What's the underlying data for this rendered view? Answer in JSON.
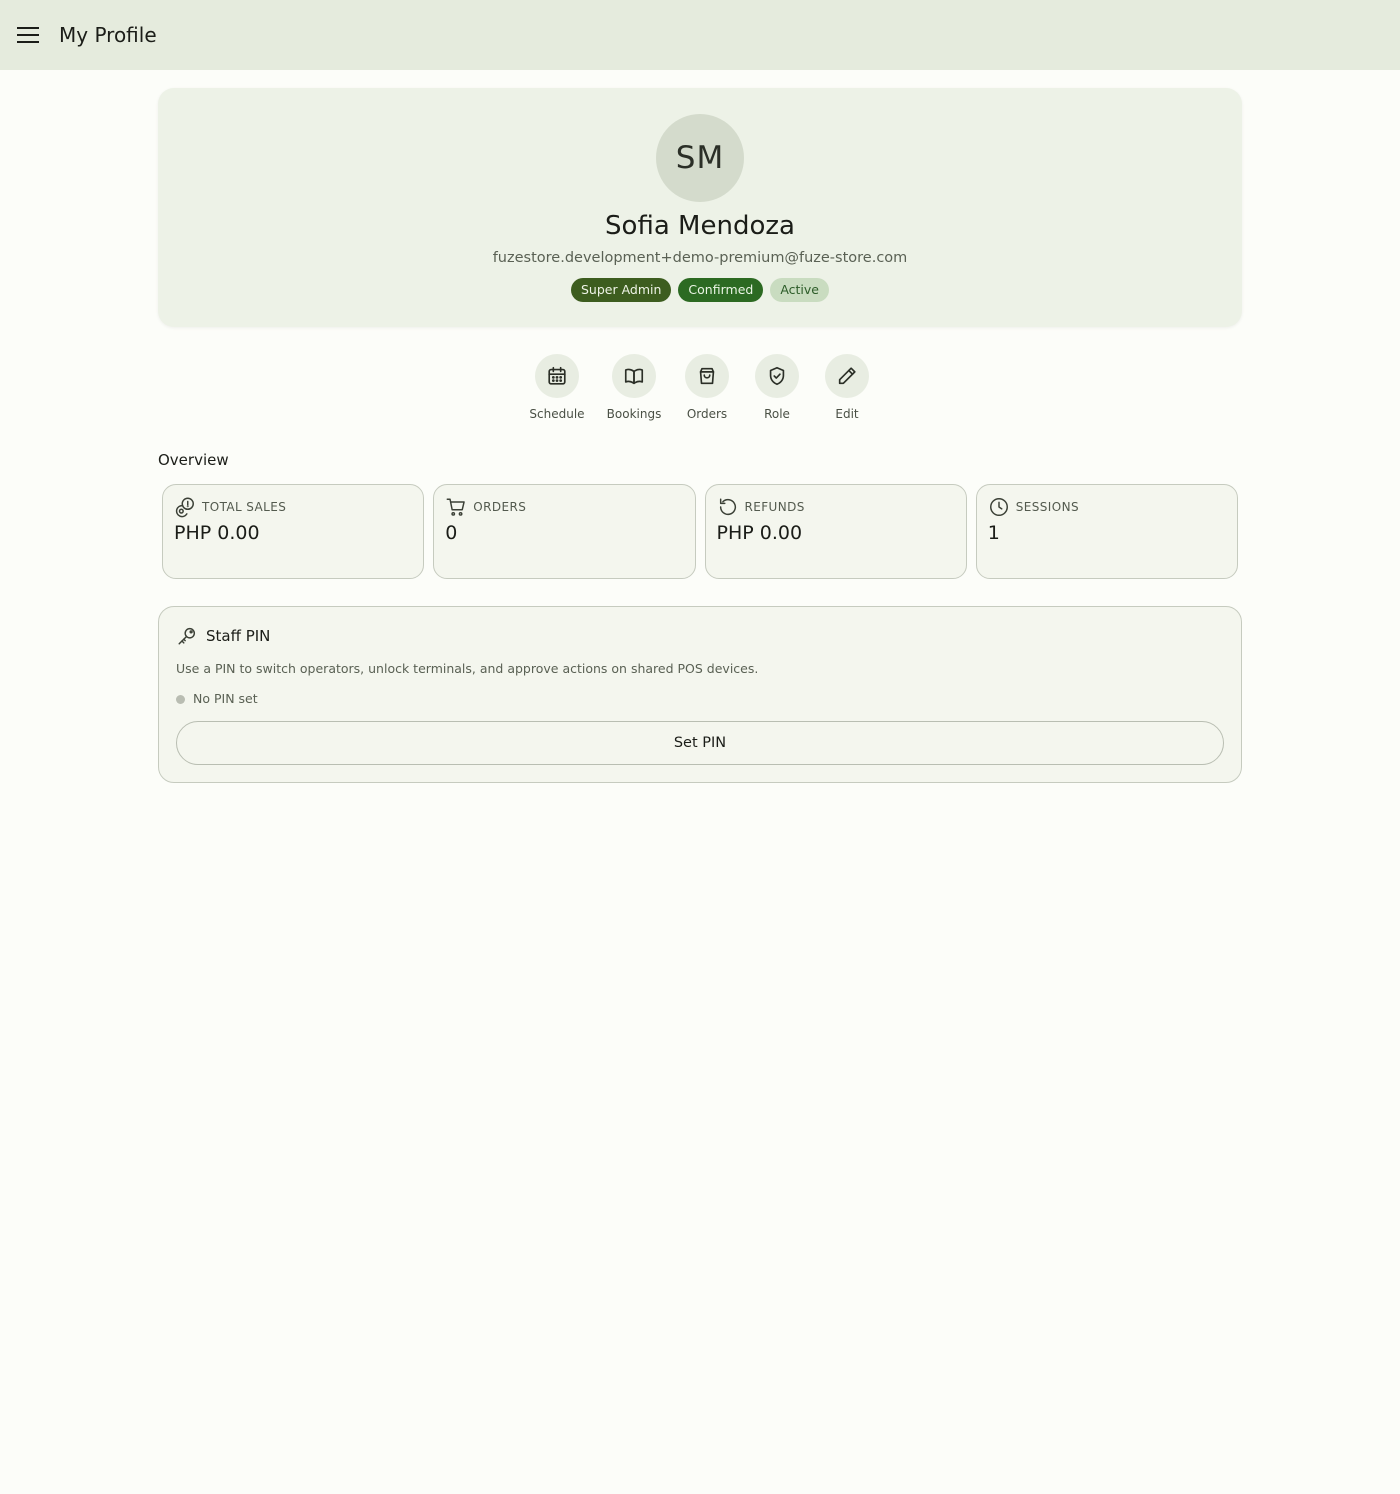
{
  "header": {
    "title": "My Profile",
    "menu_icon": "menu-icon"
  },
  "profile": {
    "initials": "SM",
    "name": "Sofia Mendoza",
    "email": "fuzestore.development+demo-premium@fuze-store.com",
    "badges": {
      "role": "Super Admin",
      "verification": "Confirmed",
      "status": "Active"
    }
  },
  "actions": [
    {
      "label": "Schedule",
      "icon": "calendar-icon"
    },
    {
      "label": "Bookings",
      "icon": "book-icon"
    },
    {
      "label": "Orders",
      "icon": "shopping-bag-icon"
    },
    {
      "label": "Role",
      "icon": "shield-check-icon"
    },
    {
      "label": "Edit",
      "icon": "pencil-icon"
    }
  ],
  "overview": {
    "title": "Overview",
    "stats": [
      {
        "label": "TOTAL SALES",
        "value": "PHP 0.00",
        "icon": "coins-icon"
      },
      {
        "label": "ORDERS",
        "value": "0",
        "icon": "cart-icon"
      },
      {
        "label": "REFUNDS",
        "value": "PHP 0.00",
        "icon": "refund-icon"
      },
      {
        "label": "SESSIONS",
        "value": "1",
        "icon": "clock-icon"
      }
    ]
  },
  "staff_pin": {
    "title": "Staff PIN",
    "description": "Use a PIN to switch operators, unlock terminals, and approve actions on shared POS devices.",
    "status": "No PIN set",
    "button_label": "Set PIN",
    "icon": "key-icon"
  },
  "colors": {
    "header_bg": "#e5ebdd",
    "card_bg": "#edf2e7",
    "badge_admin": "#3d5d1f",
    "badge_confirmed": "#2c6a22",
    "badge_active": "#c9dcc0"
  }
}
